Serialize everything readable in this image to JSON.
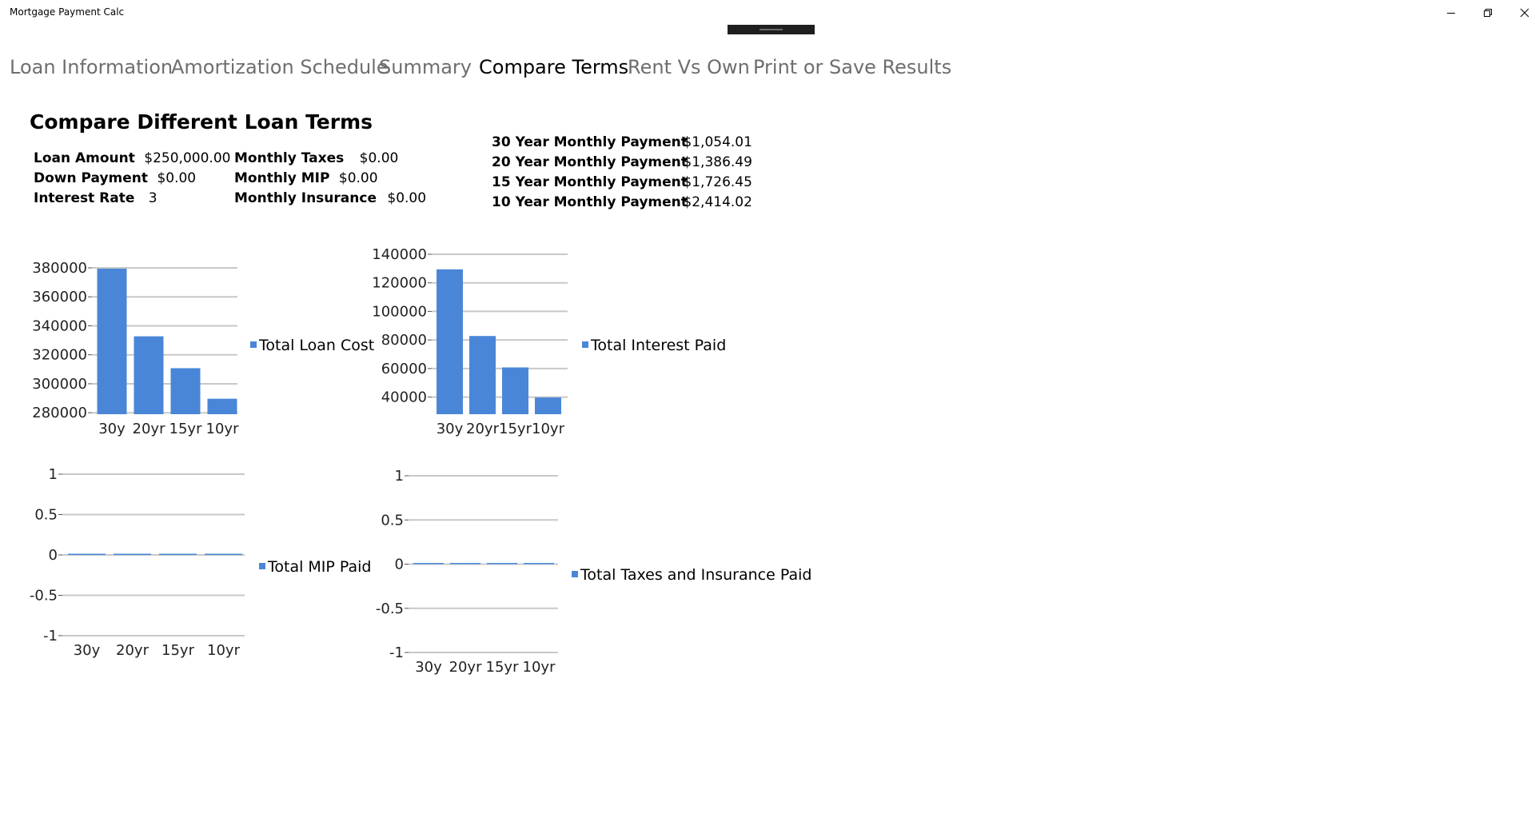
{
  "app": {
    "title": "Mortgage Payment Calc"
  },
  "window_controls": [
    {
      "name": "minimize-button",
      "icon": "minimize-icon"
    },
    {
      "name": "restore-button",
      "icon": "restore-icon"
    },
    {
      "name": "close-button",
      "icon": "close-icon"
    }
  ],
  "nav": {
    "tabs": [
      {
        "label": "Loan Information",
        "active": false
      },
      {
        "label": "Amortization Schedule",
        "active": false
      },
      {
        "label": "Summary",
        "active": false
      },
      {
        "label": "Compare Terms",
        "active": true
      },
      {
        "label": "Rent Vs Own",
        "active": false
      },
      {
        "label": "Print or Save Results",
        "active": false
      }
    ]
  },
  "page": {
    "heading": "Compare Different Loan Terms"
  },
  "loan": {
    "amount_label": "Loan Amount",
    "amount": "$250,000.00",
    "down_label": "Down Payment",
    "down": "$0.00",
    "rate_label": "Interest Rate",
    "rate": "3",
    "taxes_label": "Monthly Taxes",
    "taxes": "$0.00",
    "mip_label": "Monthly MIP",
    "mip": "$0.00",
    "insurance_label": "Monthly Insurance",
    "insurance": "$0.00"
  },
  "payments": [
    {
      "label": "30 Year Monthly Payment",
      "value": "$1,054.01"
    },
    {
      "label": "20 Year Monthly Payment",
      "value": "$1,386.49"
    },
    {
      "label": "15 Year Monthly Payment",
      "value": "$1,726.45"
    },
    {
      "label": "10 Year Monthly Payment",
      "value": "$2,414.02"
    }
  ],
  "colors": {
    "accent": "#4a86d8",
    "grid": "#c8c8c8",
    "tab_inactive": "#6e6e6e"
  },
  "chart_data": [
    {
      "type": "bar",
      "categories": [
        "30y",
        "20yr",
        "15yr",
        "10yr"
      ],
      "series": [
        {
          "name": "Total Loan Cost",
          "values": [
            379444,
            332758,
            310761,
            289682
          ]
        }
      ],
      "yticks": [
        280000,
        300000,
        320000,
        340000,
        360000,
        380000
      ],
      "ylim": [
        279000,
        380000
      ],
      "legend": "right",
      "grid": true
    },
    {
      "type": "bar",
      "categories": [
        "30y",
        "20yr",
        "15yr",
        "10yr"
      ],
      "series": [
        {
          "name": "Total Interest Paid",
          "values": [
            129444,
            82758,
            60761,
            39682
          ]
        }
      ],
      "yticks": [
        40000,
        60000,
        80000,
        100000,
        120000,
        140000
      ],
      "ylim": [
        28000,
        140000
      ],
      "legend": "right",
      "grid": true
    },
    {
      "type": "bar",
      "categories": [
        "30y",
        "20yr",
        "15yr",
        "10yr"
      ],
      "series": [
        {
          "name": "Total MIP Paid",
          "values": [
            0,
            0,
            0,
            0
          ]
        }
      ],
      "yticks": [
        -1,
        -0.5,
        0,
        0.5,
        1
      ],
      "ylim": [
        -1,
        1
      ],
      "legend": "right",
      "grid": true
    },
    {
      "type": "bar",
      "categories": [
        "30y",
        "20yr",
        "15yr",
        "10yr"
      ],
      "series": [
        {
          "name": "Total Taxes and Insurance Paid",
          "values": [
            0,
            0,
            0,
            0
          ]
        }
      ],
      "yticks": [
        -1,
        -0.5,
        0,
        0.5,
        1
      ],
      "ylim": [
        -1,
        1
      ],
      "legend": "right",
      "grid": true
    }
  ]
}
